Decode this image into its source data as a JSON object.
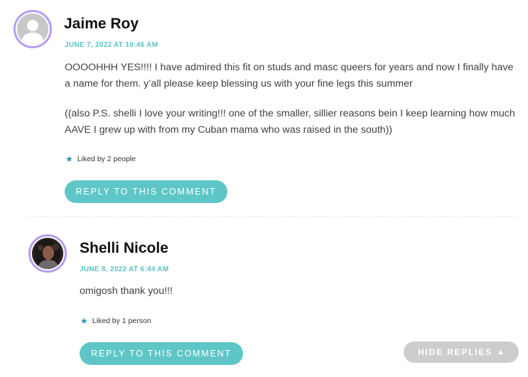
{
  "comments": [
    {
      "author": "Jaime Roy",
      "date": "JUNE 7, 2022 AT 10:46 AM",
      "paragraphs": [
        "OOOOHHH YES!!!! I have admired this fit on studs and masc queers for years and now I finally have a name for them. y’all please keep blessing us with your fine legs this summer",
        "((also P.S. shelli I love your writing!!! one of the smaller, sillier reasons bein I keep learning how much AAVE I grew up with from my Cuban mama who was raised in the south))"
      ],
      "likes": "Liked by 2 people",
      "reply_label": "REPLY TO THIS COMMENT",
      "avatar_icon": "default-user-avatar"
    },
    {
      "author": "Shelli Nicole",
      "date": "JUNE 8, 2022 AT 6:44 AM",
      "paragraphs": [
        "omigosh thank you!!!"
      ],
      "likes": "Liked by 1 person",
      "reply_label": "REPLY TO THIS COMMENT",
      "avatar_icon": "user-photo-avatar"
    }
  ],
  "hide_replies": {
    "label": "HIDE REPLIES",
    "icon": "caret-up-icon"
  },
  "colors": {
    "accent": "#5fc6c7",
    "date": "#5bc2c4",
    "avatar_border": "#b79cf0",
    "star": "#2a8fbd",
    "hide_button": "#cdcdcd"
  }
}
